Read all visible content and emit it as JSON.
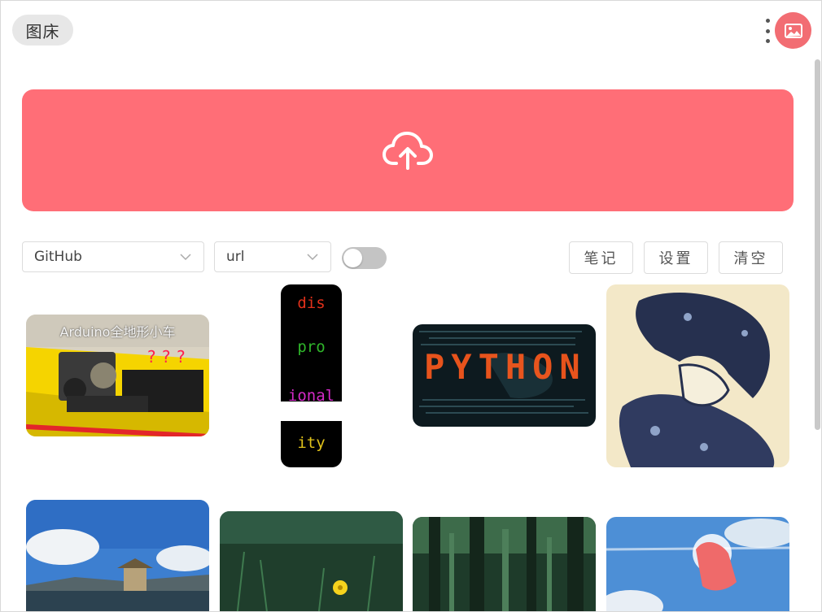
{
  "header": {
    "brand_label": "图床",
    "menu_icon": "more-vertical-icon",
    "avatar_icon": "image-icon",
    "accent_color": "#f26d73"
  },
  "upload": {
    "icon": "cloud-upload-icon",
    "color": "#ff6e77"
  },
  "controls": {
    "storage_select": {
      "value": "GitHub"
    },
    "format_select": {
      "value": "url"
    },
    "toggle": {
      "on": false
    },
    "note_button": "笔记",
    "settings_button": "设置",
    "clear_button": "清空"
  },
  "gallery": {
    "images": [
      {
        "caption": "Arduino全地形小车",
        "overlay": "???"
      },
      {
        "lines": [
          "dis",
          "pro",
          "ional",
          "ity"
        ]
      },
      {
        "word": "PYTHON"
      },
      {},
      {},
      {},
      {},
      {}
    ]
  }
}
